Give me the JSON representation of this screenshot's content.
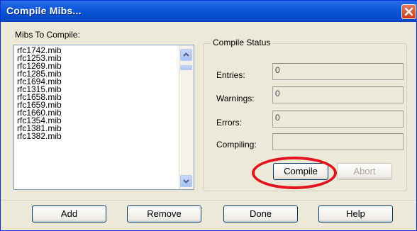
{
  "window": {
    "title": "Compile Mibs..."
  },
  "mibs": {
    "label": "Mibs To Compile:",
    "items": [
      "rfc1742.mib",
      "rfc1253.mib",
      "rfc1269.mib",
      "rfc1285.mib",
      "rfc1694.mib",
      "rfc1315.mib",
      "rfc1658.mib",
      "rfc1659.mib",
      "rfc1660.mib",
      "rfc1354.mib",
      "rfc1381.mib",
      "rfc1382.mib"
    ]
  },
  "status": {
    "title": "Compile Status",
    "entries_label": "Entries:",
    "entries_value": "0",
    "warnings_label": "Warnings:",
    "warnings_value": "0",
    "errors_label": "Errors:",
    "errors_value": "0",
    "compiling_label": "Compiling:",
    "compiling_value": "",
    "compile_button": "Compile",
    "abort_button": "Abort"
  },
  "buttons": {
    "add": "Add",
    "remove": "Remove",
    "done": "Done",
    "help": "Help"
  },
  "colors": {
    "titlebar": "#0a55d8",
    "highlight_ring": "#e5141b",
    "dialog_bg": "#ece9d8"
  },
  "icons": {
    "close": "close-icon",
    "scroll_up": "chevron-up-icon",
    "scroll_down": "chevron-down-icon"
  }
}
